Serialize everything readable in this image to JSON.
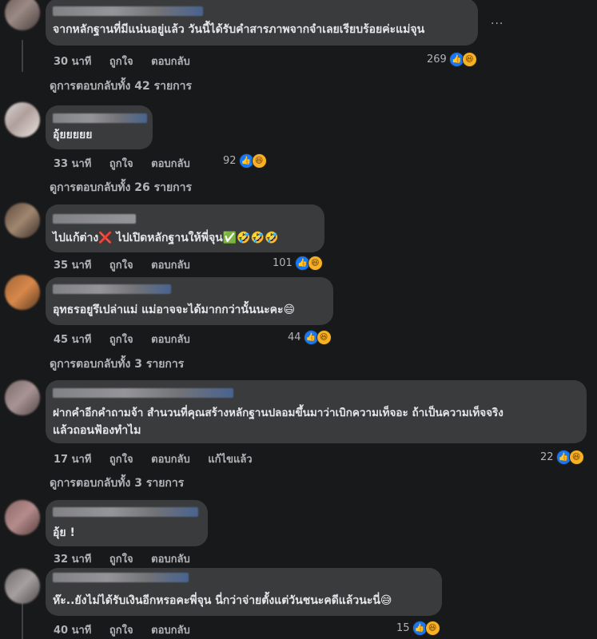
{
  "comments": [
    {
      "text": "จากหลักฐานที่มีแน่นอยู่แล้ว วันนี้ได้รับคำสารภาพจากจำเลยเรียบร้อยค่ะแม่จุน",
      "time": "30 นาที",
      "like": "ถูกใจ",
      "reply": "ตอบกลับ",
      "reaction_count": "269",
      "replies_link": "ดูการตอบกลับทั้ง 42 รายการ",
      "more": "···"
    },
    {
      "text": "อุ้ยยยยย",
      "time": "33 นาที",
      "like": "ถูกใจ",
      "reply": "ตอบกลับ",
      "reaction_count": "92",
      "replies_link": "ดูการตอบกลับทั้ง 26 รายการ"
    },
    {
      "text": "ไปแก้ต่าง❌ ไปเปิดหลักฐานให้พี่จุน✅🤣🤣🤣",
      "time": "35 นาที",
      "like": "ถูกใจ",
      "reply": "ตอบกลับ",
      "reaction_count": "101"
    },
    {
      "text": "อุทธรอยูรึเปล่าแม่ แม่อาจจะได้มากกว่านั้นนะคะ😄",
      "time": "45 นาที",
      "like": "ถูกใจ",
      "reply": "ตอบกลับ",
      "reaction_count": "44",
      "replies_link": "ดูการตอบกลับทั้ง 3 รายการ"
    },
    {
      "text_line1": "ฝากคำอีกคำถามจ้า สำนวนที่คุณสร้างหลักฐานปลอมขึ้นมาว่าเบิกความเท็จอะ ถ้าเป็นความเท็จจริง",
      "text_line2": "แล้วถอนฟ้องทำไม",
      "time": "17 นาที",
      "like": "ถูกใจ",
      "reply": "ตอบกลับ",
      "edited": "แก้ไขแล้ว",
      "reaction_count": "22",
      "replies_link": "ดูการตอบกลับทั้ง 3 รายการ"
    },
    {
      "text": "อุ้ย !",
      "time": "32 นาที",
      "like": "ถูกใจ",
      "reply": "ตอบกลับ"
    },
    {
      "text": "ห๊ะ..ยังไม่ได้รับเงินอีกหรอคะพี่จุน นี่กว่าจ่ายตั้งแต่วันชนะคดีแล้วนะนี่😅",
      "time": "40 นาที",
      "like": "ถูกใจ",
      "reply": "ตอบกลับ",
      "reaction_count": "15"
    }
  ],
  "icons": {
    "like": "like-icon",
    "haha": "haha-icon"
  },
  "colors": {
    "background": "#18191a",
    "bubble": "#3a3b3c",
    "like_blue": "#1877f2",
    "haha_yellow": "#f7b125"
  }
}
